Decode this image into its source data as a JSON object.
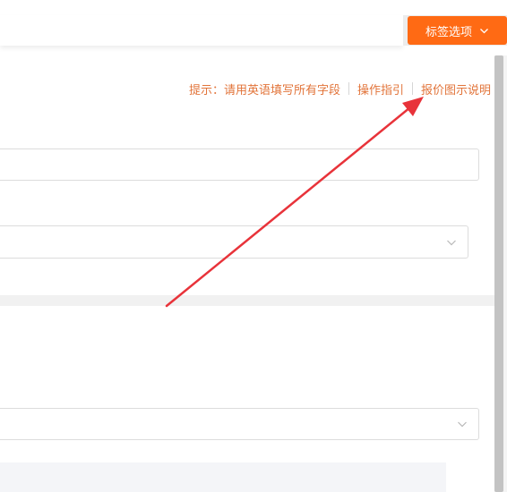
{
  "header": {
    "tag_button_label": "标签选项"
  },
  "hints": {
    "tip": "提示：请用英语填写所有字段",
    "guide_link": "操作指引",
    "price_link": "报价图示说明"
  },
  "colors": {
    "accent": "#ff6a14",
    "hint_text": "#e2743a",
    "annotation_arrow": "#e8333a"
  },
  "icons": {
    "dropdown": "chevron-down-icon",
    "annotation": "arrow-icon"
  }
}
